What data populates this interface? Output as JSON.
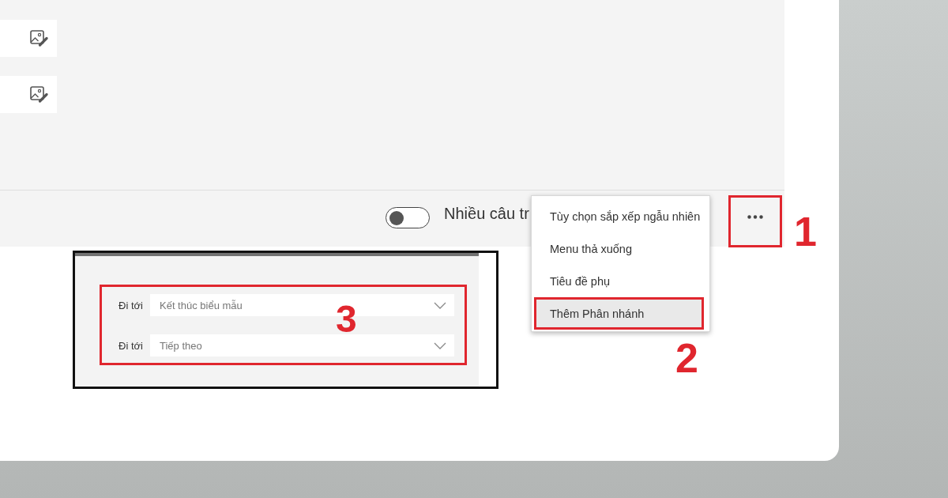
{
  "question_card": {
    "options": [
      {
        "kind": "image_option"
      },
      {
        "kind": "image_option"
      }
    ],
    "toggle": {
      "label": "Nhiều câu tr",
      "on": false
    },
    "more_button": {
      "callout": "1"
    },
    "more_menu": {
      "callout": "2",
      "items": [
        {
          "label": "Tùy chọn sắp xếp ngẫu nhiên",
          "selected": false
        },
        {
          "label": "Menu thả xuống",
          "selected": false
        },
        {
          "label": "Tiêu đề phụ",
          "selected": false
        },
        {
          "label": "Thêm Phân nhánh",
          "selected": true
        }
      ]
    }
  },
  "branch_inset": {
    "callout": "3",
    "rows": [
      {
        "label": "Đi tới",
        "value": "Kết thúc biểu mẫu"
      },
      {
        "label": "Đi tới",
        "value": "Tiếp theo"
      }
    ]
  }
}
